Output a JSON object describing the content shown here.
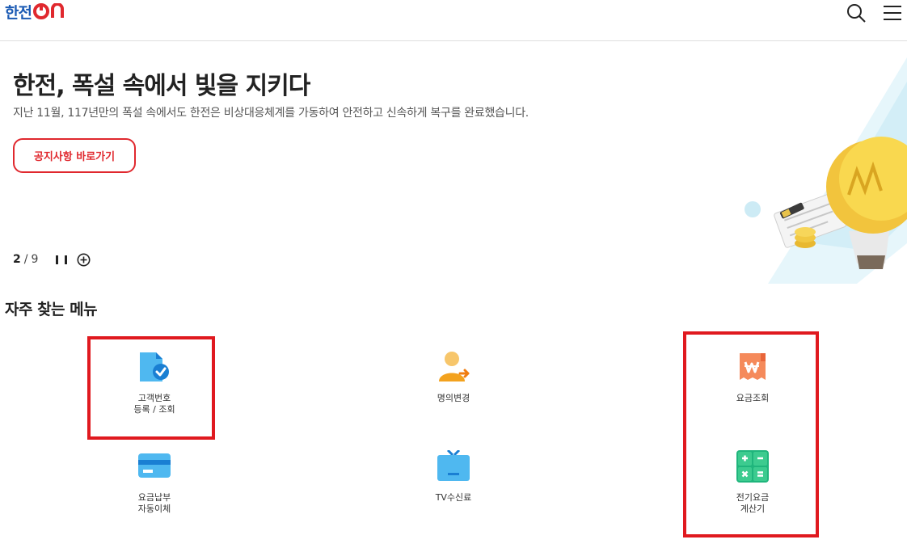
{
  "header": {
    "logo_text": "한전",
    "logo_suffix": "ON",
    "search_icon": "search-icon",
    "menu_icon": "hamburger-menu-icon"
  },
  "banner": {
    "title": "한전, 폭설 속에서 빛을 지키다",
    "description": "지난 11월, 117년만의 폭설 속에서도 한전은 비상대응체계를 가동하여 안전하고 신속하게 복구를 완료했습니다.",
    "button_label": "공지사항 바로가기",
    "slide_current": "2",
    "slide_separator": "/",
    "slide_total": "9",
    "accent_color": "#e0282e"
  },
  "quick_menu": {
    "title": "자주 찾는 메뉴",
    "items": [
      {
        "label": "고객번호\n등록 / 조회",
        "icon": "document-check-icon"
      },
      {
        "label": "명의변경",
        "icon": "person-transfer-icon"
      },
      {
        "label": "요금조회",
        "icon": "won-receipt-icon"
      },
      {
        "label": "요금납부\n자동이체",
        "icon": "credit-card-icon"
      },
      {
        "label": "TV수신료",
        "icon": "tv-icon"
      },
      {
        "label": "전기요금\n계산기",
        "icon": "calculator-icon"
      }
    ]
  },
  "highlight_color": "#e0191f"
}
